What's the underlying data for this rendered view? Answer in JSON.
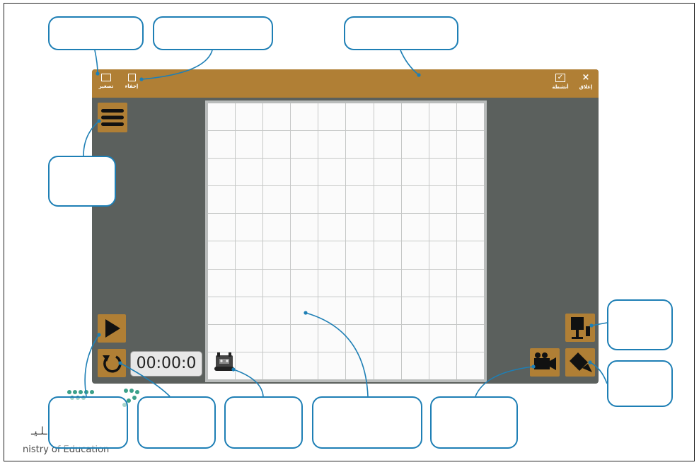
{
  "titlebar": {
    "left_buttons": [
      {
        "label": "تصغير",
        "icon": "window-icon"
      },
      {
        "label": "إخفاء",
        "icon": "hide-panel-icon"
      }
    ],
    "right_buttons": [
      {
        "label": "أنشطة",
        "icon": "activities-check-icon"
      },
      {
        "label": "إغلاق",
        "icon": "close-icon"
      }
    ],
    "color": "#b07f35"
  },
  "app": {
    "background": "#5b605d",
    "timer": "00:00:0",
    "grid": {
      "rows": 10,
      "cols": 10
    }
  },
  "controls": {
    "left": [
      "menu-icon",
      "play-icon",
      "reset-icon"
    ],
    "right": [
      "podium-camera-icon",
      "video-camera-icon",
      "rotate-camera-icon"
    ]
  },
  "logo": {
    "arabic_fragment": "ـلـيـ",
    "english_fragment": "nistry of Education",
    "dot_color": "#3aa08a"
  },
  "callout_color": "#1e7fb5"
}
